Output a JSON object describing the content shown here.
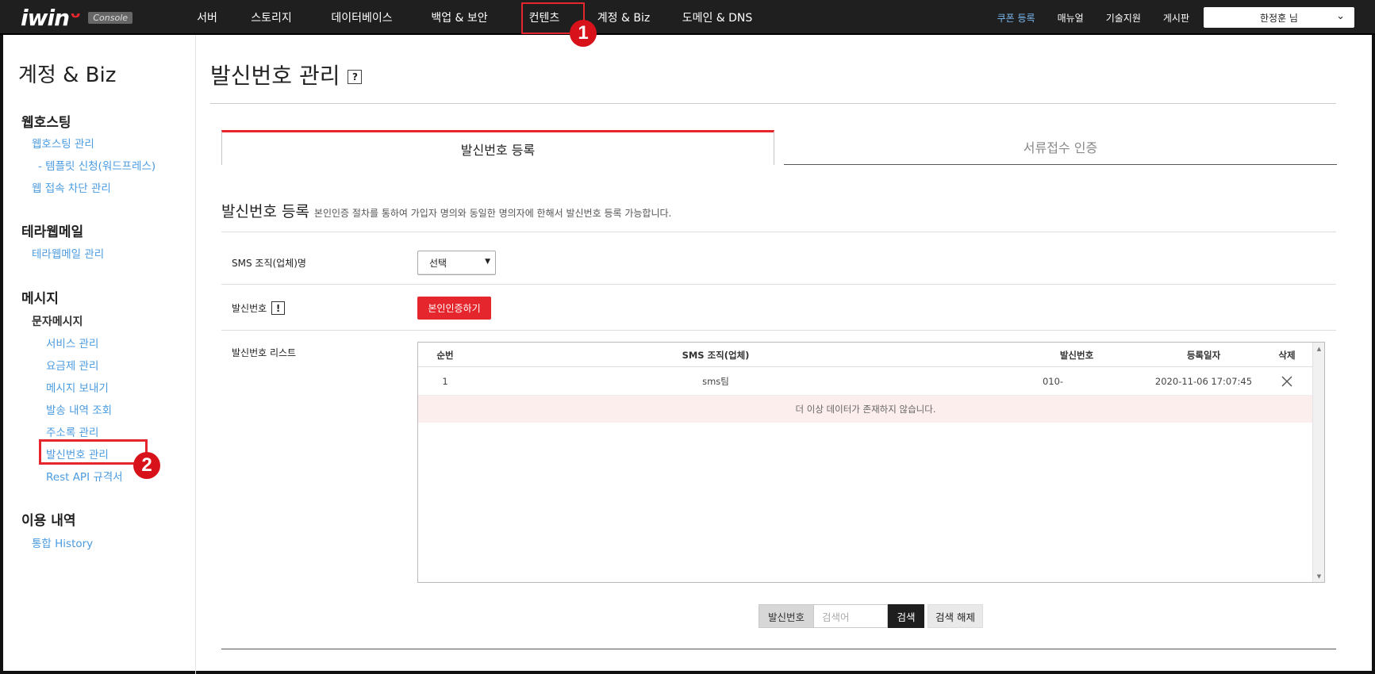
{
  "header": {
    "logo_text": "iwin",
    "logo_badge": "Console",
    "nav": [
      "서버",
      "스토리지",
      "데이터베이스",
      "백업 & 보안",
      "컨텐츠",
      "계정 & Biz",
      "도메인 & DNS"
    ],
    "right_links": {
      "coupon": "쿠폰 등록",
      "manual": "매뉴얼",
      "support": "기술지원",
      "board": "게시판"
    },
    "user": "한정훈 님"
  },
  "callouts": {
    "one": "1",
    "two": "2"
  },
  "sidebar": {
    "title": "계정 & Biz",
    "sections": {
      "webhosting": {
        "title": "웹호스팅",
        "items": [
          "웹호스팅 관리",
          "- 템플릿 신청(워드프레스)",
          "웹 접속 차단 관리"
        ]
      },
      "terramail": {
        "title": "테라웹메일",
        "items": [
          "테라웹메일 관리"
        ]
      },
      "message": {
        "title": "메시지",
        "sub": "문자메시지",
        "items": [
          "서비스 관리",
          "요금제 관리",
          "메시지 보내기",
          "발송 내역 조회",
          "주소록 관리",
          "발신번호 관리",
          "Rest API 규격서"
        ]
      },
      "history": {
        "title": "이용 내역",
        "items": [
          "통합 History"
        ]
      }
    }
  },
  "main": {
    "title": "발신번호 관리",
    "help": "?",
    "tabs": [
      "발신번호 등록",
      "서류접수 인증"
    ],
    "section": {
      "title": "발신번호 등록",
      "desc": "본인인증 절차를 통하여 가입자 명의와 동일한 명의자에 한해서 발신번호 등록 가능합니다."
    },
    "form": {
      "org_label": "SMS 조직(업체)명",
      "org_select": "선택",
      "number_label": "발신번호",
      "info": "!",
      "verify_button": "본인인증하기",
      "list_label": "발신번호 리스트"
    },
    "table": {
      "headers": [
        "순번",
        "SMS 조직(업체)",
        "발신번호",
        "등록일자",
        "삭제"
      ],
      "rows": [
        [
          "1",
          "sms팀",
          "010-",
          "2020-11-06 17:07:45"
        ]
      ],
      "empty": "더 이상 데이터가 존재하지 않습니다."
    },
    "search": {
      "label": "발신번호",
      "placeholder": "검색어",
      "button": "검색",
      "reset": "검색 해제"
    }
  },
  "colors": {
    "accent": "#e5262c",
    "link": "#4a9be0",
    "topbar": "#1f1f1f"
  }
}
